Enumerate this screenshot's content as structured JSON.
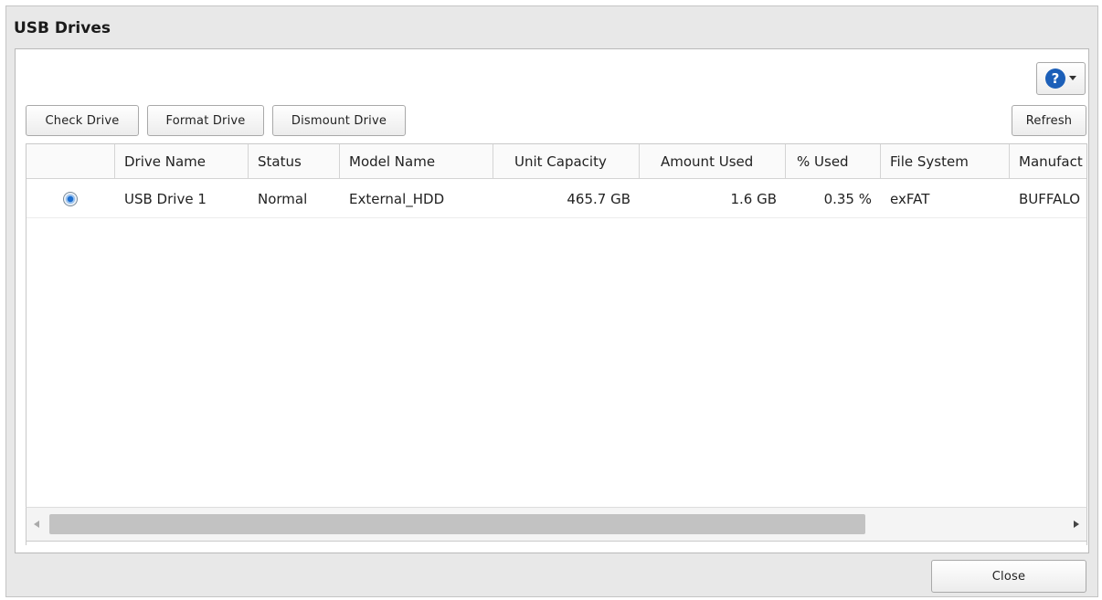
{
  "dialog": {
    "title": "USB Drives"
  },
  "toolbar": {
    "check_label": "Check Drive",
    "format_label": "Format Drive",
    "dismount_label": "Dismount Drive",
    "refresh_label": "Refresh",
    "help_icon": "question-circle-icon"
  },
  "table": {
    "columns": [
      "Drive Name",
      "Status",
      "Model Name",
      "Unit Capacity",
      "Amount Used",
      "% Used",
      "File System",
      "Manufact"
    ],
    "rows": [
      {
        "selected": true,
        "drive_name": "USB Drive 1",
        "status": "Normal",
        "model_name": "External_HDD",
        "unit_capacity": "465.7 GB",
        "amount_used": "1.6 GB",
        "percent_used": "0.35 %",
        "file_system": "exFAT",
        "manufacturer": "BUFFALO"
      }
    ]
  },
  "footer": {
    "close_label": "Close"
  },
  "colors": {
    "accent": "#1c5fb8",
    "dialog_bg": "#e8e8e8"
  }
}
